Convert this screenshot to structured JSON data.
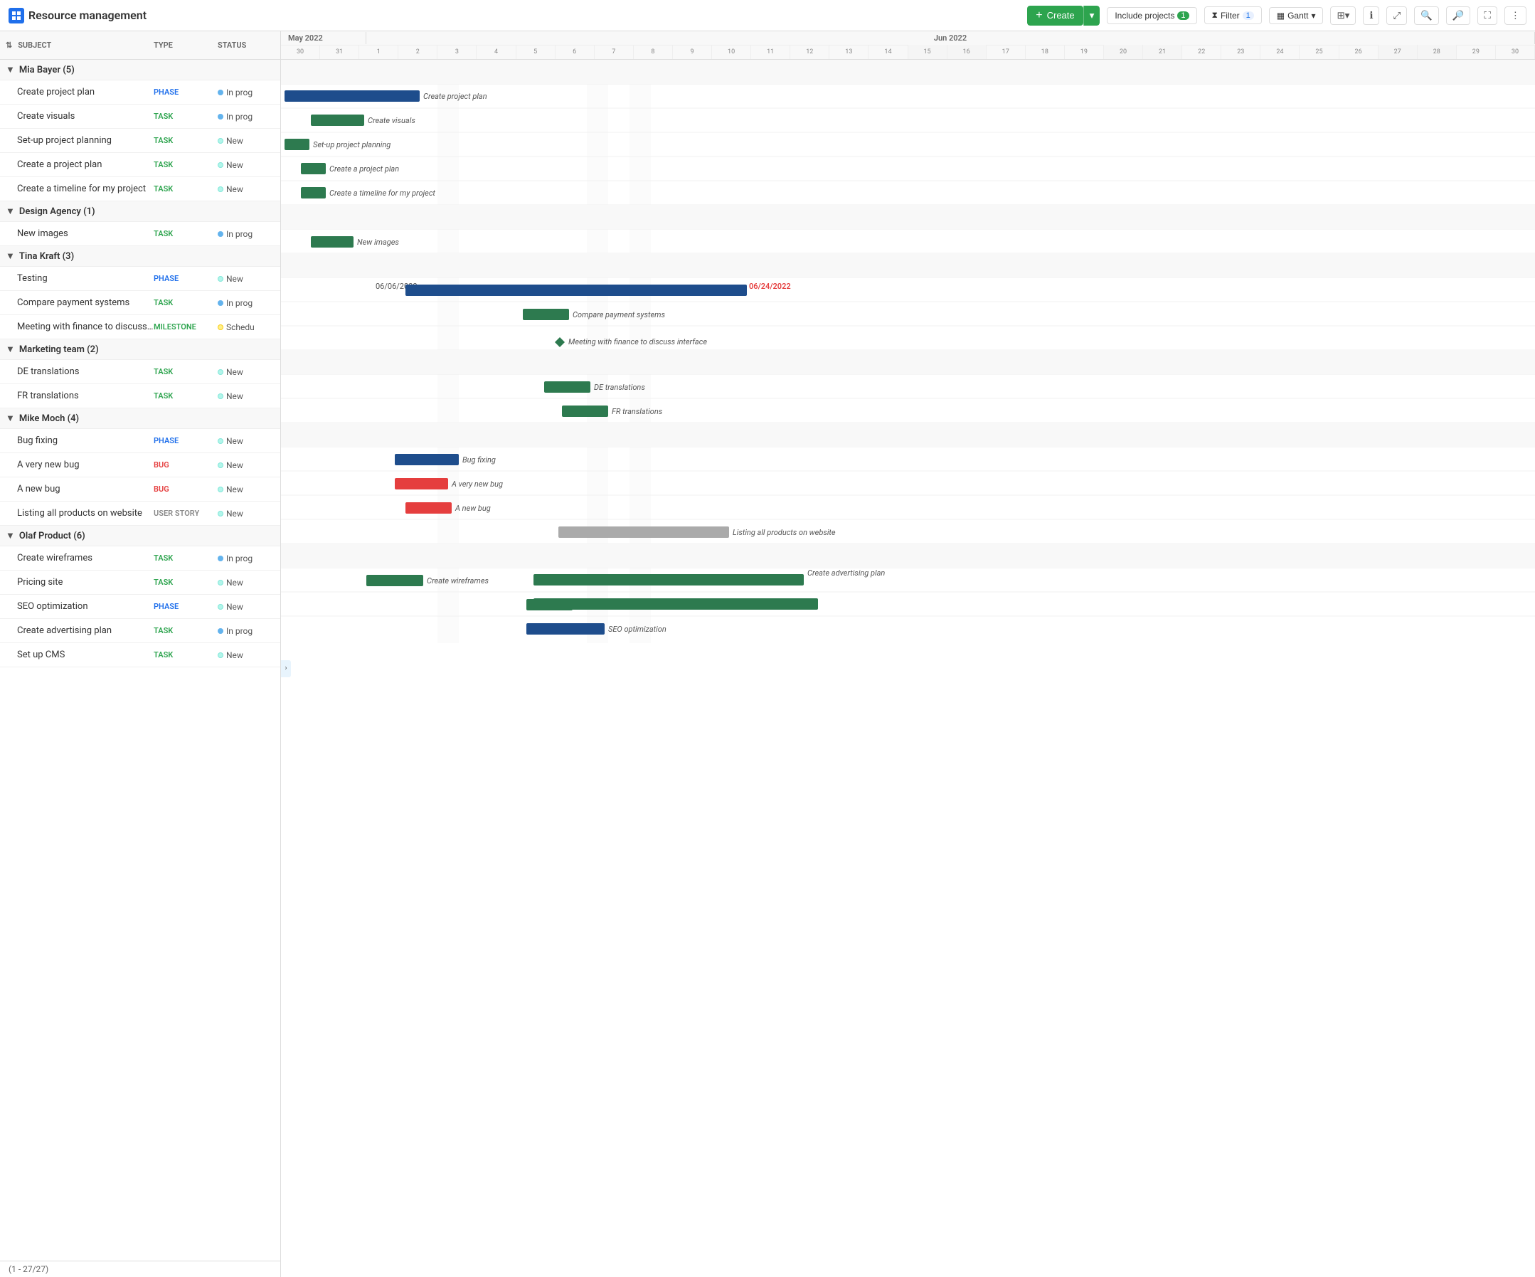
{
  "header": {
    "logo_text": "Resource management",
    "create_label": "Create",
    "include_projects_label": "Include projects",
    "include_projects_count": "1",
    "filter_label": "Filter",
    "filter_count": "1",
    "gantt_label": "Gantt",
    "toolbar_icons": [
      "grid-icon",
      "info-icon",
      "expand-icon",
      "zoom-in-icon",
      "zoom-out-icon",
      "fullscreen-icon",
      "more-icon"
    ]
  },
  "columns": {
    "sort_label": "⇅",
    "subject_label": "SUBJECT",
    "type_label": "TYPE",
    "status_label": "STATUS"
  },
  "groups": [
    {
      "name": "Mia Bayer (5)",
      "tasks": [
        {
          "name": "Create project plan",
          "type": "PHASE",
          "type_class": "phase",
          "status": "In prog",
          "status_class": "dot-inprogress"
        },
        {
          "name": "Create visuals",
          "type": "TASK",
          "type_class": "task",
          "status": "In prog",
          "status_class": "dot-inprogress"
        },
        {
          "name": "Set-up project planning",
          "type": "TASK",
          "type_class": "task",
          "status": "New",
          "status_class": "dot-new"
        },
        {
          "name": "Create a project plan",
          "type": "TASK",
          "type_class": "task",
          "status": "New",
          "status_class": "dot-new"
        },
        {
          "name": "Create a timeline for my project",
          "type": "TASK",
          "type_class": "task",
          "status": "New",
          "status_class": "dot-new"
        }
      ]
    },
    {
      "name": "Design Agency (1)",
      "tasks": [
        {
          "name": "New images",
          "type": "TASK",
          "type_class": "task",
          "status": "In prog",
          "status_class": "dot-inprogress"
        }
      ]
    },
    {
      "name": "Tina Kraft (3)",
      "tasks": [
        {
          "name": "Testing",
          "type": "PHASE",
          "type_class": "phase",
          "status": "New",
          "status_class": "dot-new"
        },
        {
          "name": "Compare payment systems",
          "type": "TASK",
          "type_class": "task",
          "status": "In prog",
          "status_class": "dot-inprogress"
        },
        {
          "name": "Meeting with finance to discuss interface",
          "type": "MILESTONE",
          "type_class": "milestone",
          "status": "Schedu",
          "status_class": "dot-scheduled"
        }
      ]
    },
    {
      "name": "Marketing team (2)",
      "tasks": [
        {
          "name": "DE translations",
          "type": "TASK",
          "type_class": "task",
          "status": "New",
          "status_class": "dot-new"
        },
        {
          "name": "FR translations",
          "type": "TASK",
          "type_class": "task",
          "status": "New",
          "status_class": "dot-new"
        }
      ]
    },
    {
      "name": "Mike Moch (4)",
      "tasks": [
        {
          "name": "Bug fixing",
          "type": "PHASE",
          "type_class": "phase",
          "status": "New",
          "status_class": "dot-new"
        },
        {
          "name": "A very new bug",
          "type": "BUG",
          "type_class": "bug",
          "status": "New",
          "status_class": "dot-new"
        },
        {
          "name": "A new bug",
          "type": "BUG",
          "type_class": "bug",
          "status": "New",
          "status_class": "dot-new"
        },
        {
          "name": "Listing all products on website",
          "type": "USER STORY",
          "type_class": "user-story",
          "status": "New",
          "status_class": "dot-new"
        }
      ]
    },
    {
      "name": "Olaf Product (6)",
      "tasks": [
        {
          "name": "Create wireframes",
          "type": "TASK",
          "type_class": "task",
          "status": "In prog",
          "status_class": "dot-inprogress"
        },
        {
          "name": "Pricing site",
          "type": "TASK",
          "type_class": "task",
          "status": "New",
          "status_class": "dot-new"
        },
        {
          "name": "SEO optimization",
          "type": "PHASE",
          "type_class": "phase",
          "status": "New",
          "status_class": "dot-new"
        },
        {
          "name": "Create advertising plan",
          "type": "TASK",
          "type_class": "task",
          "status": "In prog",
          "status_class": "dot-inprogress"
        },
        {
          "name": "Set up CMS",
          "type": "TASK",
          "type_class": "task",
          "status": "New",
          "status_class": "dot-new"
        }
      ]
    }
  ],
  "footer": {
    "label": "(1 - 27/27)"
  },
  "gantt": {
    "timeline_label": "Jun 2022"
  }
}
